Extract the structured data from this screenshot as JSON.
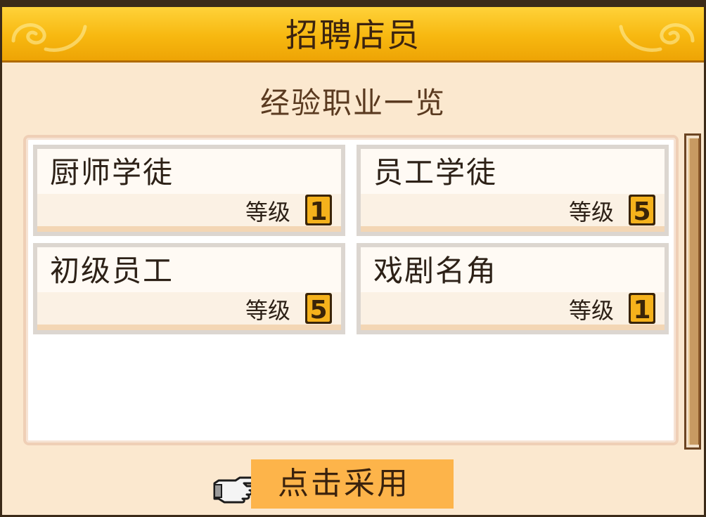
{
  "dialog": {
    "title": "招聘店员",
    "subtitle": "经验职业一览"
  },
  "jobs": [
    {
      "name": "厨师学徒",
      "level_label": "等级",
      "level": "1"
    },
    {
      "name": "员工学徒",
      "level_label": "等级",
      "level": "5"
    },
    {
      "name": "初级员工",
      "level_label": "等级",
      "level": "5"
    },
    {
      "name": "戏剧名角",
      "level_label": "等级",
      "level": "1"
    }
  ],
  "action": {
    "label": "点击采用",
    "icon": "pointing-hand-icon"
  },
  "scroll": {
    "position": 0
  },
  "colors": {
    "title_gold": "#f7b810",
    "panel_bg": "#fbe8cf",
    "button_orange": "#fdb44a",
    "badge_gold": "#f5b21c"
  }
}
